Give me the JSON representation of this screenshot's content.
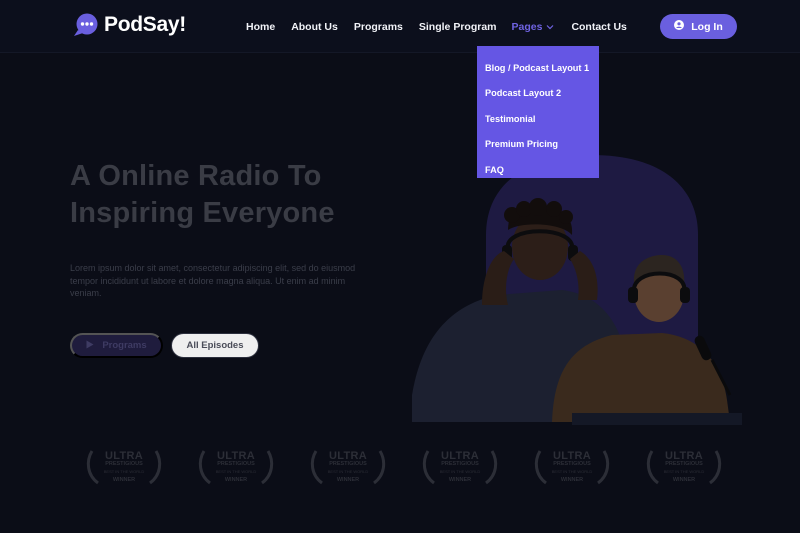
{
  "brand": {
    "name": "PodSay!",
    "accent": "#6a5fdf"
  },
  "nav": {
    "items": [
      {
        "label": "Home"
      },
      {
        "label": "About Us"
      },
      {
        "label": "Programs"
      },
      {
        "label": "Single Program"
      },
      {
        "label": "Pages",
        "active": true,
        "icon": "chevron-down-icon"
      },
      {
        "label": "Contact Us"
      }
    ],
    "login_label": "Log In",
    "login_icon": "user-icon"
  },
  "dropdown": {
    "items": [
      "Blog / Podcast Layout 1",
      "Podcast Layout 2",
      "Testimonial",
      "Premium Pricing",
      "FAQ"
    ]
  },
  "hero": {
    "title_line1": "A Online Radio To",
    "title_line2": "Inspiring Everyone",
    "description": "Lorem ipsum dolor sit amet, consectetur adipiscing elit, sed do eiusmod tempor incididunt ut labore et dolore magna aliqua. Ut enim ad minim veniam.",
    "primary_button": "Programs",
    "primary_icon": "play-icon",
    "secondary_button": "All Episodes"
  },
  "awards": [
    {
      "line1": "ULTRA",
      "line2": "PRESTIGIOUS",
      "line3": "BEST IN THE WORLD",
      "line4": "WINNER"
    },
    {
      "line1": "ULTRA",
      "line2": "PRESTIGIOUS",
      "line3": "BEST IN THE WORLD",
      "line4": "WINNER"
    },
    {
      "line1": "ULTRA",
      "line2": "PRESTIGIOUS",
      "line3": "BEST IN THE WORLD",
      "line4": "WINNER"
    },
    {
      "line1": "ULTRA",
      "line2": "PRESTIGIOUS",
      "line3": "BEST IN THE WORLD",
      "line4": "WINNER"
    },
    {
      "line1": "ULTRA",
      "line2": "PRESTIGIOUS",
      "line3": "BEST IN THE WORLD",
      "line4": "WINNER"
    },
    {
      "line1": "ULTRA",
      "line2": "PRESTIGIOUS",
      "line3": "BEST IN THE WORLD",
      "line4": "WINNER"
    }
  ]
}
